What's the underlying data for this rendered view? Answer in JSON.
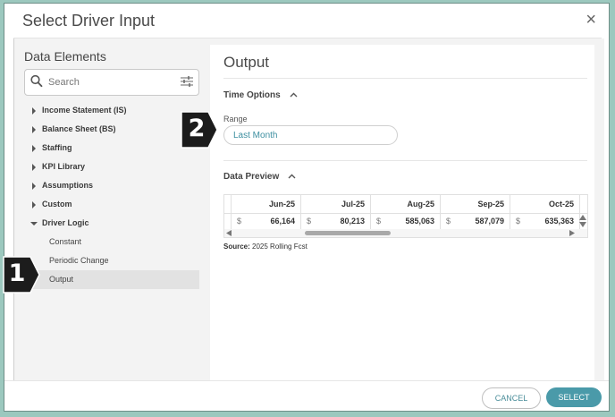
{
  "dialog": {
    "title": "Select Driver Input",
    "close_glyph": "×"
  },
  "sidebar": {
    "title": "Data Elements",
    "search": {
      "placeholder": "Search",
      "value": ""
    },
    "items": [
      {
        "label": "Income Statement (IS)",
        "expanded": false
      },
      {
        "label": "Balance Sheet (BS)",
        "expanded": false
      },
      {
        "label": "Staffing",
        "expanded": false
      },
      {
        "label": "KPI Library",
        "expanded": false
      },
      {
        "label": "Assumptions",
        "expanded": false
      },
      {
        "label": "Custom",
        "expanded": false
      },
      {
        "label": "Driver Logic",
        "expanded": true,
        "children": [
          {
            "label": "Constant",
            "selected": false
          },
          {
            "label": "Periodic Change",
            "selected": false
          },
          {
            "label": "Output",
            "selected": true
          }
        ]
      }
    ]
  },
  "main": {
    "title": "Output",
    "time_options": {
      "label": "Time Options",
      "range_label": "Range",
      "range_value": "Last Month"
    },
    "data_preview": {
      "label": "Data Preview",
      "columns": [
        "Jun-25",
        "Jul-25",
        "Aug-25",
        "Sep-25",
        "Oct-25"
      ],
      "currency_symbol": "$",
      "values": [
        "66,164",
        "80,213",
        "585,063",
        "587,079",
        "635,363"
      ],
      "source_label": "Source:",
      "source_value": "2025 Rolling Fcst"
    }
  },
  "footer": {
    "cancel_label": "CANCEL",
    "select_label": "SELECT"
  },
  "callouts": [
    "1",
    "2"
  ],
  "colors": {
    "accent": "#4a9aa9",
    "link": "#3d8fa0",
    "frame": "#9cc8be",
    "callout": "#1c1c1c"
  }
}
